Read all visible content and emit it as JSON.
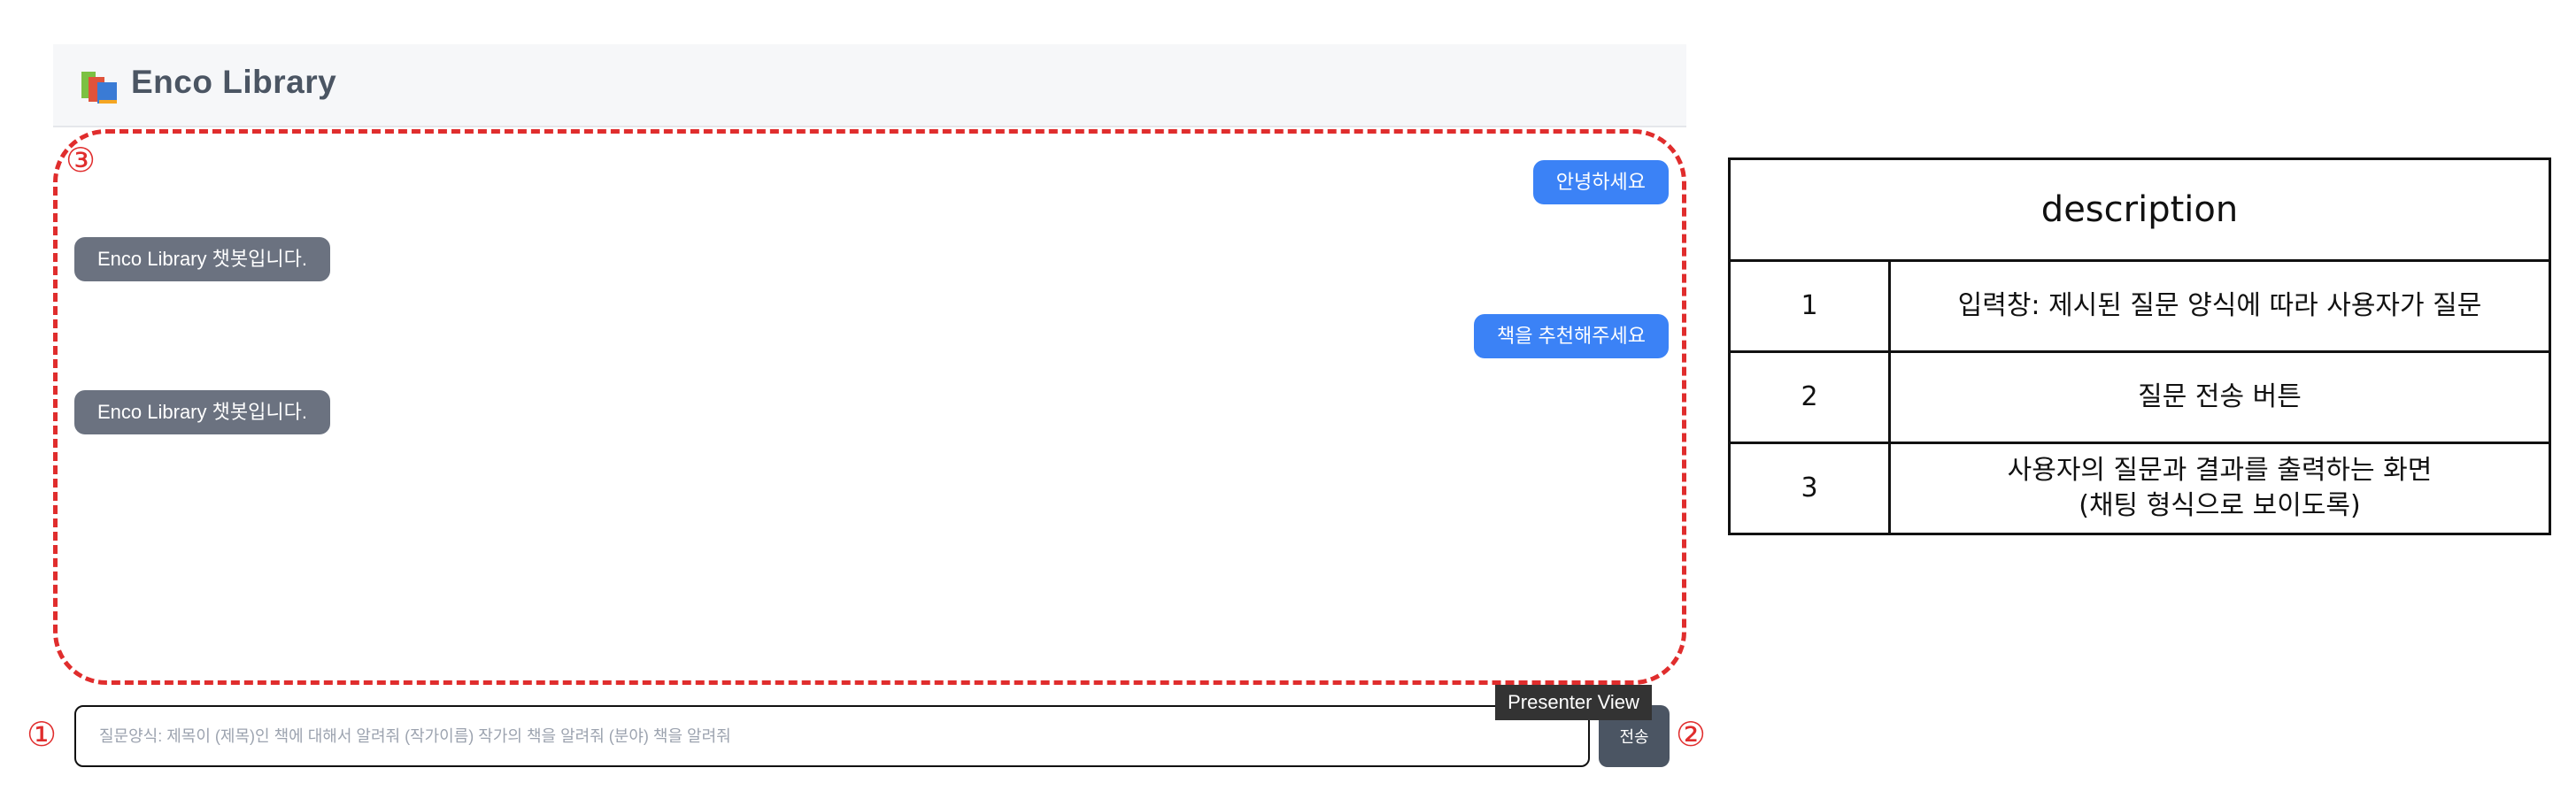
{
  "header": {
    "title": "Enco Library",
    "logo_icon": "books-icon"
  },
  "chat": {
    "messages": [
      {
        "role": "user",
        "text": "안녕하세요"
      },
      {
        "role": "bot",
        "text": "Enco Library 챗봇입니다."
      },
      {
        "role": "user",
        "text": "책을 추천해주세요"
      },
      {
        "role": "bot",
        "text": "Enco Library 챗봇입니다."
      }
    ]
  },
  "input": {
    "placeholder": "질문양식: 제목이 (제목)인 책에 대해서 알려줘 (작가이름) 작가의 책을 알려줘 (분야) 책을 알려줘",
    "value": ""
  },
  "send_button": {
    "label": "전송"
  },
  "tooltip": {
    "text": "Presenter View"
  },
  "markers": {
    "m1": "①",
    "m2": "②",
    "m3": "③"
  },
  "description_table": {
    "header": "description",
    "rows": [
      {
        "num": "1",
        "text_lines": [
          "입력창: 제시된 질문 양식에 따라 사용자가 질문"
        ]
      },
      {
        "num": "2",
        "text_lines": [
          "질문 전송 버튼"
        ]
      },
      {
        "num": "3",
        "text_lines": [
          "사용자의 질문과 결과를 출력하는 화면",
          "(채팅 형식으로 보이도록)"
        ]
      }
    ]
  },
  "colors": {
    "user_bubble": "#3b82f6",
    "bot_bubble": "#6b7280",
    "annotation": "#e02d2d",
    "header_bg": "#f6f7f9"
  }
}
